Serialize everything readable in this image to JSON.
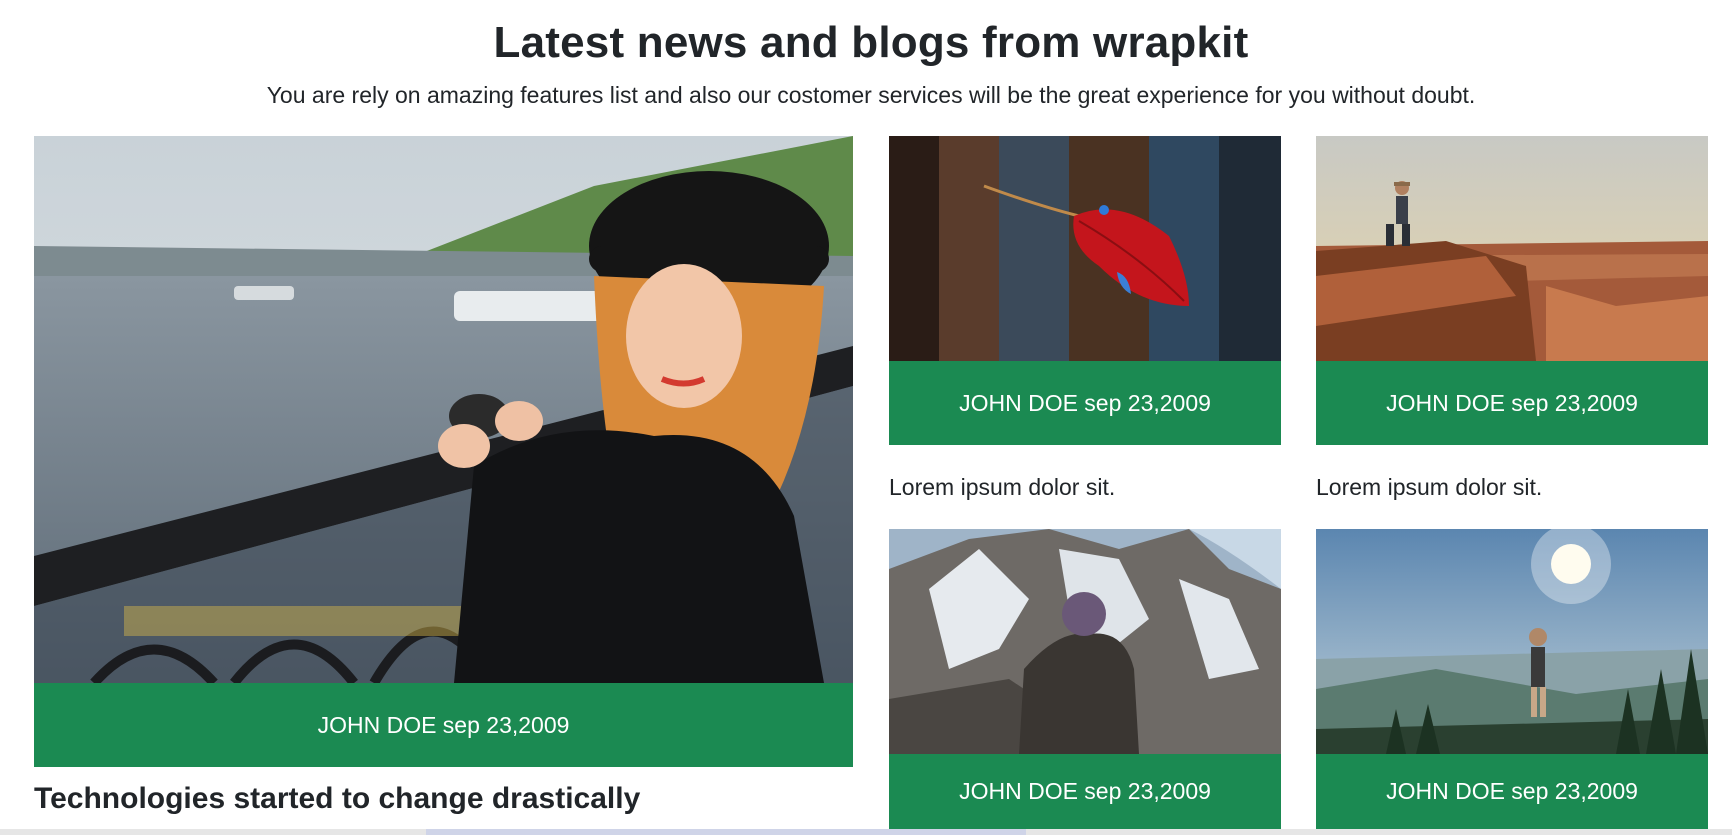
{
  "header": {
    "title": "Latest news and blogs from wrapkit",
    "subtitle": "You are rely on amazing features list and also our costomer services will be the great experience for you without doubt."
  },
  "featured": {
    "meta": "JOHN DOE sep 23,2009",
    "caption": "Technologies started to change drastically",
    "image": "woman-with-binoculars-on-bridge"
  },
  "posts": [
    {
      "meta": "JOHN DOE sep 23,2009",
      "caption": "Lorem ipsum dolor sit.",
      "image": "red-leaf-on-wood"
    },
    {
      "meta": "JOHN DOE sep 23,2009",
      "caption": "Lorem ipsum dolor sit.",
      "image": "hiker-on-canyon-cliff"
    },
    {
      "meta": "JOHN DOE sep 23,2009",
      "caption": "",
      "image": "man-facing-snowy-mountains"
    },
    {
      "meta": "JOHN DOE sep 23,2009",
      "caption": "",
      "image": "hiker-facing-sunlit-valley"
    }
  ],
  "colors": {
    "accent": "#1b8a52",
    "text": "#212529"
  }
}
